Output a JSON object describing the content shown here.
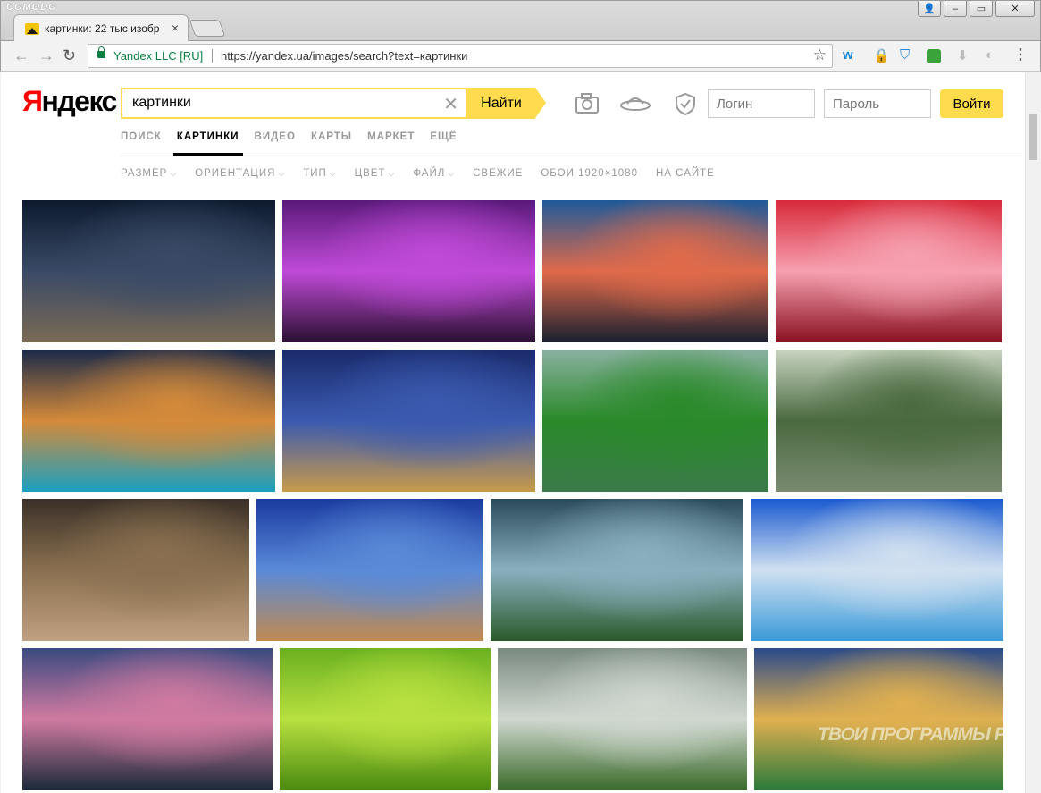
{
  "browser": {
    "brand": "COMODO",
    "tab_title": "картинки: 22 тыс изобр",
    "tab_close": "×",
    "security_label": "Yandex LLC [RU]",
    "url": "https://yandex.ua/images/search?text=картинки",
    "window_buttons": {
      "user": "👤",
      "minimize": "–",
      "maximize": "▭",
      "close": "✕"
    }
  },
  "header": {
    "logo_first": "Я",
    "logo_rest": "ндекс",
    "search_value": "картинки",
    "search_button": "Найти",
    "login_placeholder": "Логин",
    "password_placeholder": "Пароль",
    "login_button": "Войти"
  },
  "services": [
    "ПОИСК",
    "КАРТИНКИ",
    "ВИДЕО",
    "КАРТЫ",
    "МАРКЕТ",
    "ЕЩЁ"
  ],
  "active_service": "КАРТИНКИ",
  "filters": [
    {
      "label": "РАЗМЕР",
      "dropdown": true
    },
    {
      "label": "ОРИЕНТАЦИЯ",
      "dropdown": true
    },
    {
      "label": "ТИП",
      "dropdown": true
    },
    {
      "label": "ЦВЕТ",
      "dropdown": true
    },
    {
      "label": "ФАЙЛ",
      "dropdown": true
    },
    {
      "label": "СВЕЖИЕ",
      "dropdown": false
    },
    {
      "label": "ОБОИ 1920×1080",
      "dropdown": false
    },
    {
      "label": "НА САЙТЕ",
      "dropdown": false
    }
  ],
  "image_rows": [
    [
      {
        "subject": "night-lake-pier",
        "colors": [
          "#0d1a2e",
          "#3a4a66",
          "#7a6a55"
        ]
      },
      {
        "subject": "purple-bridge-city",
        "colors": [
          "#5a1a7a",
          "#c04ad8",
          "#2a1030"
        ]
      },
      {
        "subject": "sunset-rocky-coast",
        "colors": [
          "#1e5a9a",
          "#e06a4a",
          "#1a2030"
        ]
      },
      {
        "subject": "strawberries-milk-splash",
        "colors": [
          "#d82a3a",
          "#f6a0b0",
          "#8a1020"
        ]
      }
    ],
    [
      {
        "subject": "dubai-marina-night",
        "colors": [
          "#1a2a4a",
          "#d48a3a",
          "#1aa0c0"
        ]
      },
      {
        "subject": "eiffel-tower-night",
        "colors": [
          "#1a2a6a",
          "#3a5ab0",
          "#c89a4a"
        ]
      },
      {
        "subject": "green-lake-forest",
        "colors": [
          "#8ab0a0",
          "#2a8a2a",
          "#3a7a4a"
        ]
      },
      {
        "subject": "eiffel-tower-park",
        "colors": [
          "#c8d4c0",
          "#4a6a40",
          "#7a8a70"
        ]
      }
    ],
    [
      {
        "subject": "atv-rider-mud",
        "colors": [
          "#3a3028",
          "#8a7050",
          "#c0a080"
        ]
      },
      {
        "subject": "beach-rocks-blue",
        "colors": [
          "#1a3aa0",
          "#5a8ad8",
          "#c08a50"
        ]
      },
      {
        "subject": "sunlit-meadow-sky",
        "colors": [
          "#2a4a5a",
          "#8ab0c0",
          "#2a5a2a"
        ]
      },
      {
        "subject": "clouds-over-sea",
        "colors": [
          "#1a5ad0",
          "#d0e0f0",
          "#3a9ad8"
        ]
      }
    ],
    [
      {
        "subject": "mountain-lake-sunset",
        "colors": [
          "#3a4a80",
          "#d07aa0",
          "#1a2a3a"
        ]
      },
      {
        "subject": "lime-slices",
        "colors": [
          "#6ab020",
          "#b8e040",
          "#4a8a10"
        ]
      },
      {
        "subject": "sun-rays-valley",
        "colors": [
          "#7a8a80",
          "#d0d8d0",
          "#3a6a2a"
        ]
      },
      {
        "subject": "tropical-beach-sunset",
        "colors": [
          "#2a4a8a",
          "#e0b050",
          "#2a7a3a"
        ]
      }
    ]
  ],
  "watermark": "ТВОИ ПРОГРАММЫ РУ"
}
